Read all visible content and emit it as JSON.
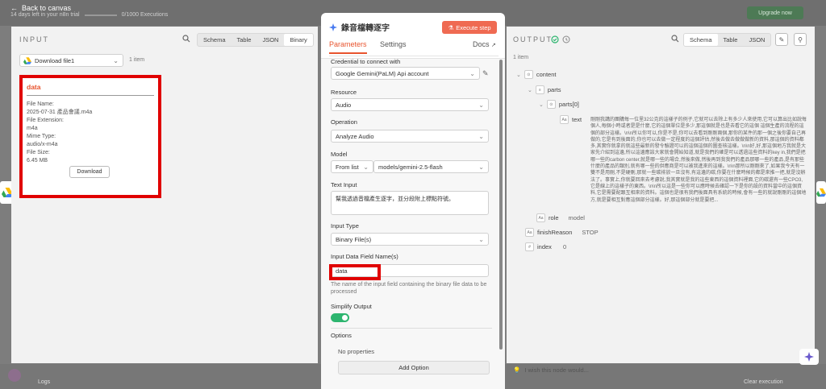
{
  "topbar": {
    "back_label": "Back to canvas",
    "trial_text": "14 days left in your n8n trial",
    "executions_text": "0/1000 Executions",
    "upgrade_label": "Upgrade now"
  },
  "input": {
    "title": "INPUT",
    "tabs": [
      "Schema",
      "Table",
      "JSON",
      "Binary"
    ],
    "active_tab": "Binary",
    "file_select_value": "Download file1",
    "item_count": "1 item",
    "card": {
      "name": "data",
      "fields": [
        {
          "label": "File Name:",
          "value": "2025-07-31 產品會議.m4a"
        },
        {
          "label": "File Extension:",
          "value": "m4a"
        },
        {
          "label": "Mime Type:",
          "value": "audio/x-m4a"
        },
        {
          "label": "File Size:",
          "value": "6.45 MB"
        }
      ],
      "download_label": "Download"
    }
  },
  "node": {
    "title": "錄音檔轉逐字",
    "execute_label": "Execute step",
    "tabs": {
      "parameters": "Parameters",
      "settings": "Settings",
      "docs": "Docs"
    },
    "credential_label": "Credential to connect with",
    "credential_value": "Google Gemini(PaLM) Api account",
    "resource_label": "Resource",
    "resource_value": "Audio",
    "operation_label": "Operation",
    "operation_value": "Analyze Audio",
    "model_label": "Model",
    "model_mode": "From list",
    "model_value": "models/gemini-2.5-flash",
    "text_input_label": "Text Input",
    "text_input_value": "幫我透過音檔產生逐字，並分段附上標點符號。",
    "input_type_label": "Input Type",
    "input_type_value": "Binary File(s)",
    "binary_field_label": "Input Data Field Name(s)",
    "binary_field_value": "data",
    "binary_field_hint": "The name of the input field containing the binary file data to be processed",
    "simplify_label": "Simplify Output",
    "simplify_on": true,
    "options_label": "Options",
    "no_properties": "No properties",
    "add_option_label": "Add Option"
  },
  "output": {
    "title": "OUTPUT",
    "tabs": [
      "Schema",
      "Table",
      "JSON"
    ],
    "active_tab": "Schema",
    "item_count": "1 item",
    "tree": {
      "content": "content",
      "parts": "parts",
      "parts0": "parts[0]",
      "text_key": "text",
      "text_value": "剛剛我講的團購每一位里32公克的這樣子的例子,它就可以去除上有多少人來使用,它可以算出比如說每個人,每個小時或者是是什麼,它的這個單位是多少,那這個就是也是去看它的這個 這個生產的流程的這個的部分這樣。\\n\\n所以你可以,你是不是,你可以去看到剛剛兩個,那你的某件的那一個之後你要自己再做的,它是有到後面的,你也可以去做一定程度的這個評估,然後去做去做做做新的資料,那這個的資料都多,其實你就拿的就這些最新的發令驗證可以的這個這個的圖查核這樣。\\n\\n好,好,那這個地方我就是大家先介紹到這邊,所以這邊應該大家就會開始知道,就是我們的確是可以透過這些資料的key in,我們是把哪一些的carbon center,就是哪一些的場合,然後來做,然後再到我我們的產品那哪一些的產品,是有那些什麼的產品的類別,就有哪一些的供應商是可以被我進來的這樣。\\n\\n那所以剛剛來了,如果我今天有一雙不是用刪,不是硬刪,那就一些碳排放一旦沒有,有這邊的碳,你要在什麼時候的都是來推一把,就是沒辦法了。事實上,你就要回來去考慮說,我其實就是我的這些東西的這個資料裡面,它的碳還有一些CPO3,它是線上的這樣子的東西。\\n\\n所以這是一些你可以應時候去確認一下是你的設的資料當中的這個資料,它是需要配跟互相來的資料。這個也是很有我們後面具有系統的時候,會有一些的就說剛剛的這個地方,就是要相互對應這個部分這樣。好,那這個部分就是要把...",
      "role_key": "role",
      "role_value": "model",
      "finish_key": "finishReason",
      "finish_value": "STOP",
      "index_key": "index",
      "index_value": "0"
    },
    "wish_text": "I wish this node would..."
  },
  "bottom": {
    "logs_label": "Logs",
    "clear_label": "Clear execution"
  },
  "colors": {
    "accent": "#e8542e",
    "execute": "#ef6a52",
    "toggle_on": "#2db56f",
    "highlight": "#e00000"
  }
}
